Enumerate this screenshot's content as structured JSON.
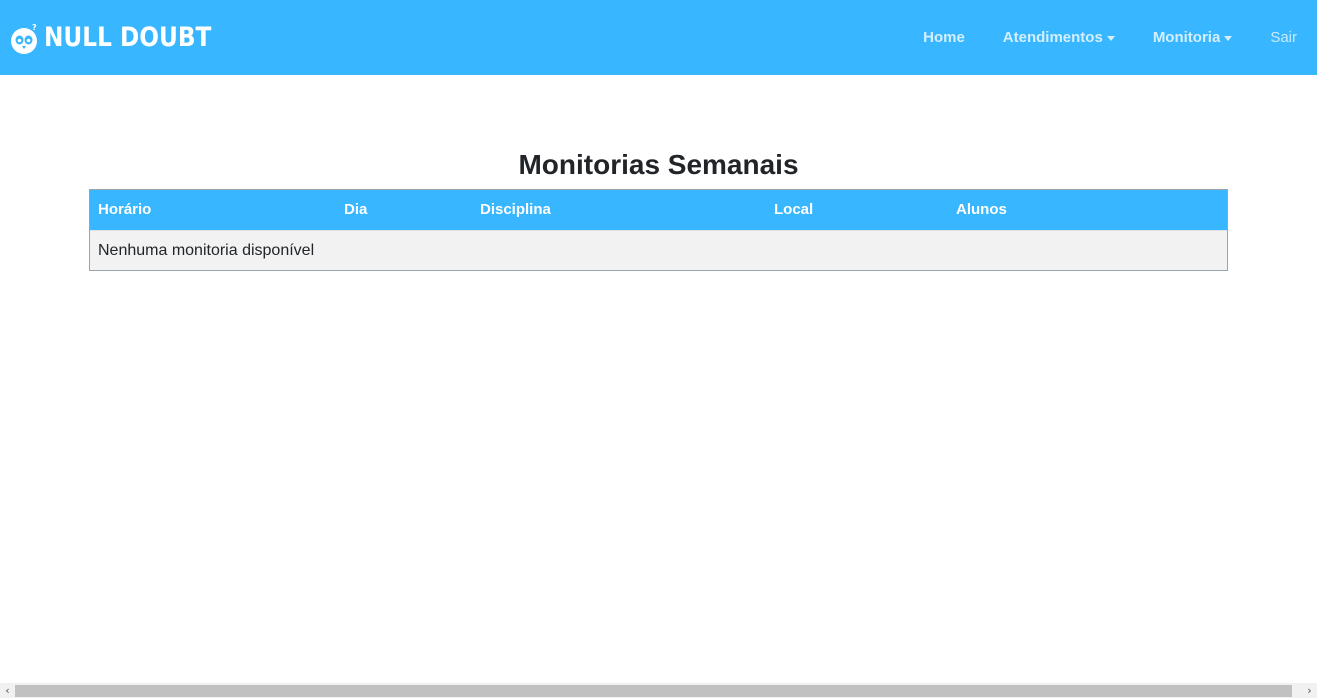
{
  "navbar": {
    "brand_text": "NULL DOUBT",
    "bg_color": "#38b6ff",
    "links": [
      {
        "label": "Home",
        "dropdown": false
      },
      {
        "label": "Atendimentos",
        "dropdown": true
      },
      {
        "label": "Monitoria",
        "dropdown": true
      },
      {
        "label": "Sair",
        "dropdown": false
      }
    ]
  },
  "main": {
    "title": "Monitorias Semanais",
    "table": {
      "columns": [
        "Horário",
        "Dia",
        "Disciplina",
        "Local",
        "Alunos"
      ],
      "empty_message": "Nenhuma monitoria disponível"
    }
  },
  "scrollbar": {
    "left_arrow": "‹",
    "right_arrow": "›"
  }
}
